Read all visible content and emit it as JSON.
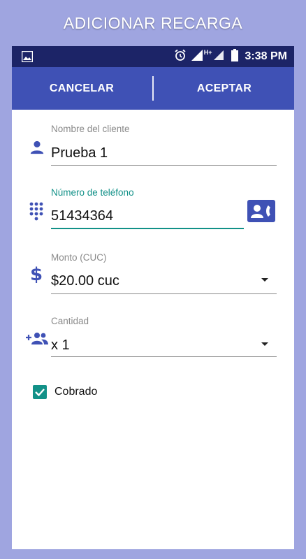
{
  "promo_title": "ADICIONAR RECARGA",
  "status_bar": {
    "time": "3:38 PM",
    "network": "H+"
  },
  "app_bar": {
    "cancel_label": "CANCELAR",
    "accept_label": "ACEPTAR"
  },
  "form": {
    "client_name": {
      "label": "Nombre del cliente",
      "value": "Prueba 1"
    },
    "phone": {
      "label": "Número de teléfono",
      "value": "51434364"
    },
    "amount": {
      "label": "Monto (CUC)",
      "value": "$20.00 cuc"
    },
    "quantity": {
      "label": "Cantidad",
      "value": "x 1"
    },
    "charged": {
      "label": "Cobrado",
      "checked": true
    }
  },
  "colors": {
    "primary": "#3f51b5",
    "status_bar": "#1c2467",
    "accent": "#129188",
    "background": "#9fa5e0"
  }
}
